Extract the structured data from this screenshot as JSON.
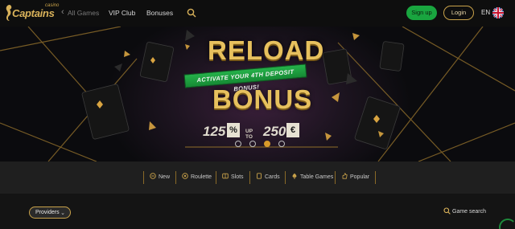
{
  "header": {
    "logo_small": "casino",
    "logo_big": "Captains",
    "nav": [
      {
        "label": "All Games",
        "faded": true
      },
      {
        "label": "VIP Club"
      },
      {
        "label": "Bonuses"
      }
    ],
    "signup_label": "Sign up",
    "login_label": "Login",
    "language": "EN"
  },
  "banner": {
    "title_top": "RELOAD",
    "ribbon_text": "ACTIVATE YOUR 4TH DEPOSIT BONUS!",
    "title_bottom": "BONUS",
    "percent_value": "125",
    "percent_symbol": "%",
    "up_to": "UP TO",
    "amount": "250",
    "currency": "€",
    "slides": 4,
    "active_slide": 3
  },
  "categories": [
    {
      "label": "New",
      "icon": "new-icon"
    },
    {
      "label": "Roulette",
      "icon": "roulette-icon"
    },
    {
      "label": "Slots",
      "icon": "slots-icon"
    },
    {
      "label": "Cards",
      "icon": "cards-icon"
    },
    {
      "label": "Table Games",
      "icon": "table-games-icon"
    },
    {
      "label": "Popular",
      "icon": "popular-icon"
    }
  ],
  "lower": {
    "providers_label": "Providers",
    "game_search_label": "Game search"
  },
  "colors": {
    "gold": "#d9b25a",
    "green": "#19a53f",
    "active_dot": "#d89a2a"
  }
}
